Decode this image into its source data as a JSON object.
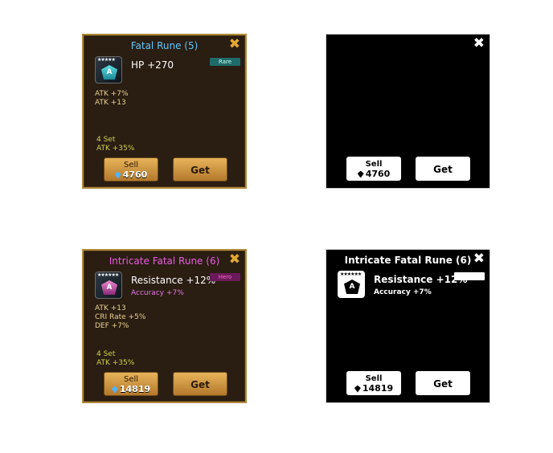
{
  "panel1": {
    "title": "Fatal Rune (5)",
    "stars": "★★★★★",
    "rune_glyph": "A",
    "main_stat": "HP +270",
    "grade": "Rare",
    "subs": [
      "ATK +7%",
      "ATK +13"
    ],
    "set_count": "4 Set",
    "set_bonus": "ATK +35%",
    "sell_label": "Sell",
    "sell_amount": "4760",
    "get_label": "Get",
    "title_color": "#5ec8ff",
    "close": "✖"
  },
  "panel2": {
    "sell_label": "Sell",
    "sell_amount": "4760",
    "get_label": "Get",
    "close": "✖"
  },
  "panel3": {
    "title": "Intricate Fatal Rune (6)",
    "stars": "★★★★★★",
    "rune_glyph": "A",
    "main_stat": "Resistance +12%",
    "prefix": "Accuracy +7%",
    "grade": "Hero",
    "subs": [
      "ATK +13",
      "CRI Rate +5%",
      "DEF +7%"
    ],
    "set_count": "4 Set",
    "set_bonus": "ATK +35%",
    "sell_label": "Sell",
    "sell_amount": "14819",
    "get_label": "Get",
    "title_color": "#e85ce0",
    "close": "✖"
  },
  "panel4": {
    "title": "Intricate Fatal Rune (6)",
    "stars": "★★★★★★",
    "rune_glyph": "A",
    "main_stat": "Resistance +12%",
    "prefix": "Accuracy +7%",
    "sell_label": "Sell",
    "sell_amount": "14819",
    "get_label": "Get",
    "close": "✖"
  }
}
